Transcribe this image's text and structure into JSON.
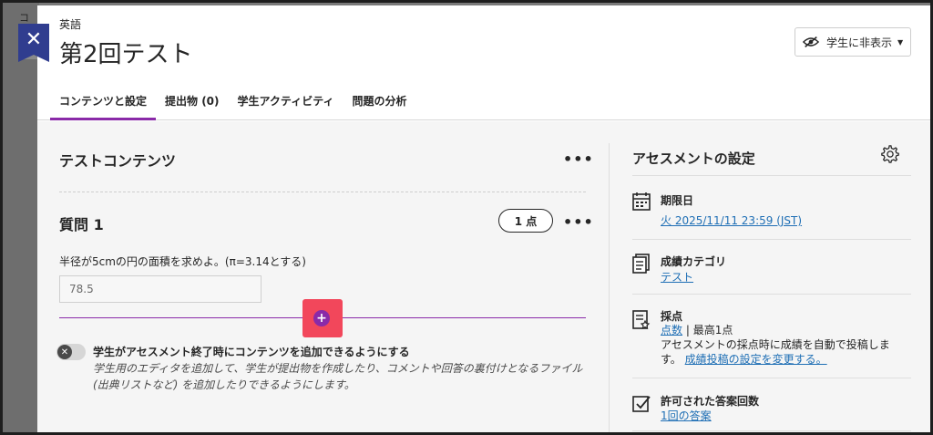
{
  "background": {
    "partial_text": "コ"
  },
  "header": {
    "breadcrumb": "英語",
    "title": "第2回テスト",
    "visibility_label": "学生に非表示"
  },
  "tabs": [
    {
      "label": "コンテンツと設定",
      "active": true
    },
    {
      "label": "提出物 (0)",
      "active": false
    },
    {
      "label": "学生アクティビティ",
      "active": false
    },
    {
      "label": "問題の分析",
      "active": false
    }
  ],
  "content": {
    "section_title": "テストコンテンツ",
    "more_label": "•••",
    "question": {
      "title": "質問 1",
      "points": "1 点",
      "text": "半径が5cmの円の面積を求めよ。(π=3.14とする)",
      "answer": "78.5"
    },
    "add_symbol": "+",
    "toggle": {
      "label": "学生がアセスメント終了時にコンテンツを追加できるようにする",
      "description": "学生用のエディタを追加して、学生が提出物を作成したり、コメントや回答の裏付けとなるファイル (出典リストなど) を追加したりできるようにします。",
      "enabled": false
    }
  },
  "settings": {
    "title": "アセスメントの設定",
    "due_date": {
      "label": "期限日",
      "value": "火 2025/11/11 23:59 (JST)"
    },
    "grade_category": {
      "label": "成績カテゴリ",
      "value": "テスト"
    },
    "grading": {
      "label": "採点",
      "link": "点数",
      "max_text": " | 最高1点",
      "description": "アセスメントの採点時に成績を自動で投稿します。",
      "change_link": "成績投稿の設定を変更する。"
    },
    "attempts": {
      "label": "許可された答案回数",
      "value": "1回の答案"
    }
  },
  "colors": {
    "accent": "#8a2aa8",
    "close_button": "#303d8f",
    "link": "#1f6fb5",
    "highlight": "#f2475b"
  }
}
